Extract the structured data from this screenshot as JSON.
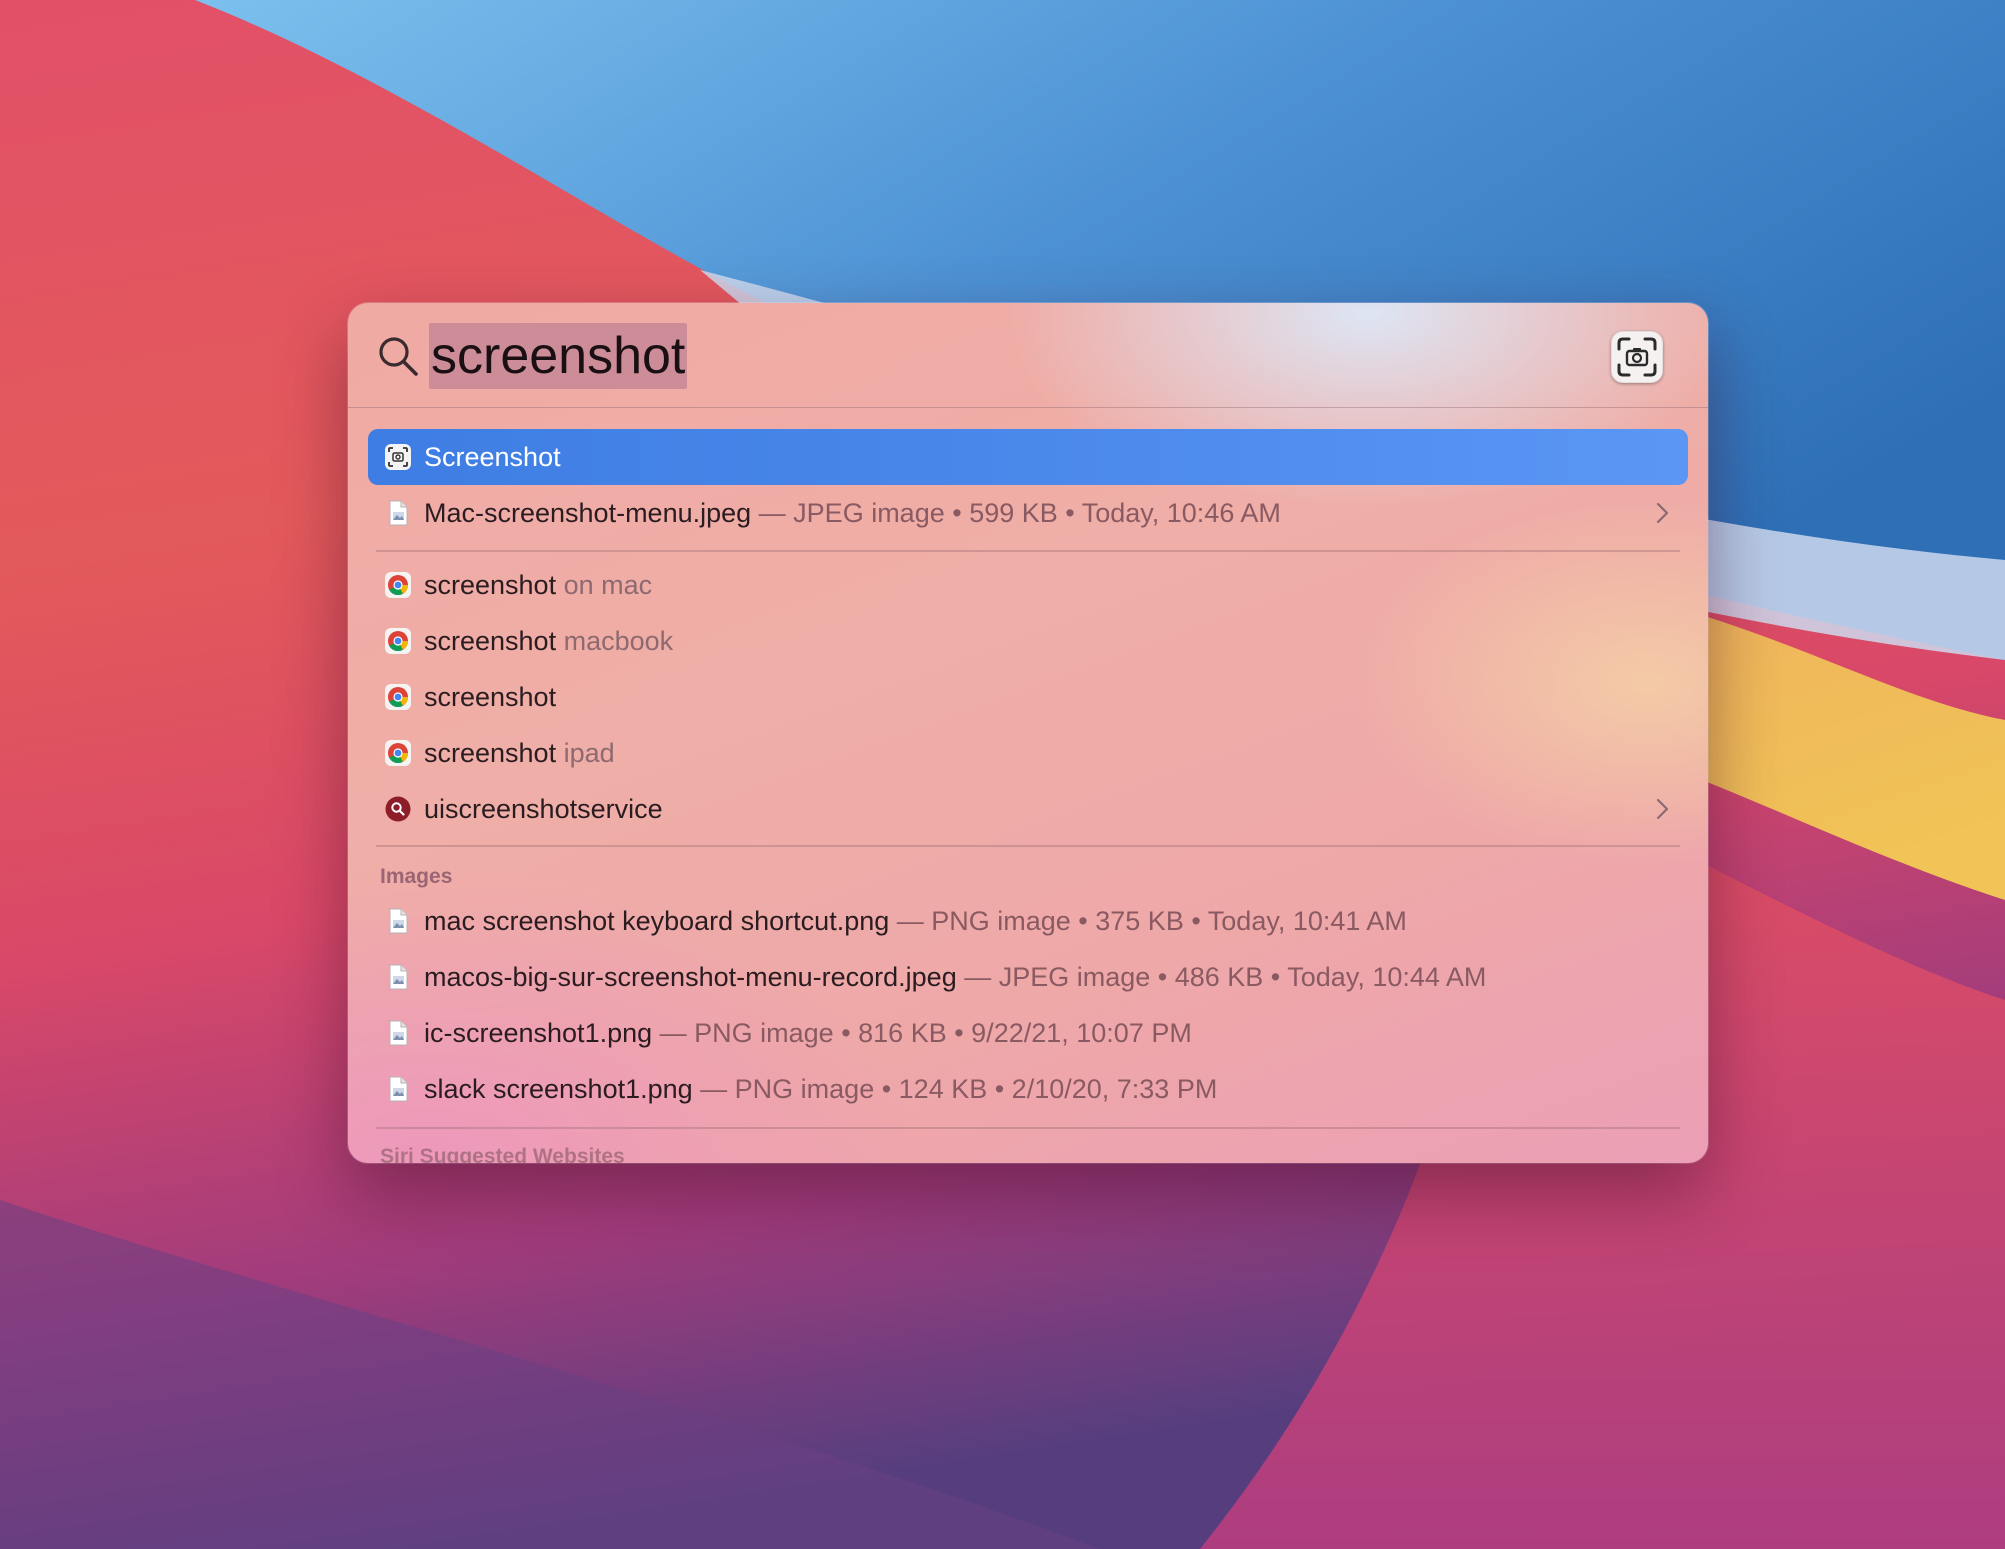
{
  "search": {
    "query": "screenshot"
  },
  "top_hits": [
    {
      "name": "Screenshot",
      "icon": "screenshot-app-icon",
      "selected": true
    },
    {
      "name": "Mac-screenshot-menu.jpeg",
      "meta": "— JPEG image • 599 KB • Today, 10:46 AM",
      "icon": "image-file-icon",
      "has_chevron": true
    }
  ],
  "suggestions": [
    {
      "term": "screenshot",
      "hint": " on mac",
      "icon": "chrome-icon"
    },
    {
      "term": "screenshot",
      "hint": " macbook",
      "icon": "chrome-icon"
    },
    {
      "term": "screenshot",
      "hint": "",
      "icon": "chrome-icon"
    },
    {
      "term": "screenshot",
      "hint": " ipad",
      "icon": "chrome-icon"
    },
    {
      "term": "uiscreenshotservice",
      "hint": "",
      "icon": "web-search-icon",
      "has_chevron": true
    }
  ],
  "images_section": {
    "title": "Images",
    "items": [
      {
        "name": "mac screenshot keyboard shortcut.png",
        "meta": " — PNG image • 375 KB • Today, 10:41 AM"
      },
      {
        "name": "macos-big-sur-screenshot-menu-record.jpeg",
        "meta": " — JPEG image • 486 KB • Today, 10:44 AM"
      },
      {
        "name": "ic-screenshot1.png",
        "meta": " — PNG image • 816 KB • 9/22/21, 10:07 PM"
      },
      {
        "name": "slack screenshot1.png",
        "meta": " — PNG image • 124 KB • 2/10/20, 7:33 PM"
      }
    ]
  },
  "siri_section": {
    "title": "Siri Suggested Websites"
  },
  "colors": {
    "selection": "#4a88ea",
    "wallpaper_red": "#d9455a",
    "wallpaper_blue": "#4a8bd0",
    "wallpaper_orange": "#eeaa55"
  }
}
